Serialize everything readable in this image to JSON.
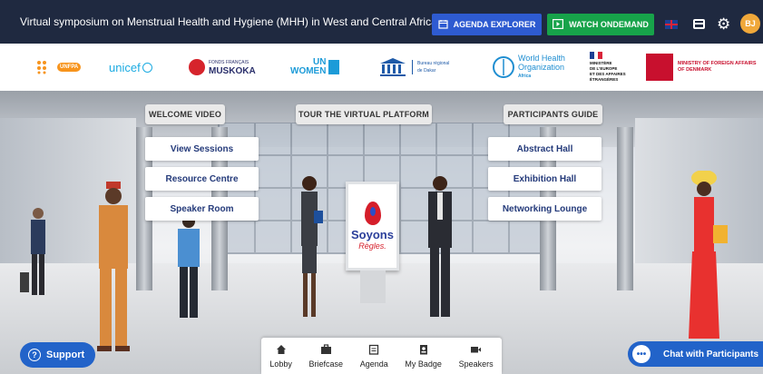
{
  "header": {
    "title": "Virtual symposium on Menstrual Health and Hygiene (MHH) in West and Central Africa",
    "agenda_label": "AGENDA EXPLORER",
    "ondemand_label": "WATCH ONDEMAND",
    "avatar_initials": "BJ"
  },
  "logos": {
    "unfpa": "UNFPA",
    "unicef": "unicef",
    "muskoka_small": "FONDS FRANÇAIS",
    "muskoka": "MUSKOKA",
    "unwomen_1": "UN",
    "unwomen_2": "WOMEN",
    "unesco_1": "Bureau régional",
    "unesco_2": "de Dakar",
    "who_1": "World Health",
    "who_2": "Organization",
    "who_3": "Africa",
    "france_1": "MINISTÈRE",
    "france_2": "DE L'EUROPE",
    "france_3": "ET DES AFFAIRES",
    "france_4": "ÉTRANGÈRES",
    "denmark_1": "MINISTRY OF FOREIGN AFFAIRS",
    "denmark_2": "OF DENMARK"
  },
  "signs": {
    "welcome": "WELCOME VIDEO",
    "tour": "TOUR THE VIRTUAL PLATFORM",
    "guide": "PARTICIPANTS GUIDE"
  },
  "halls": {
    "left": [
      "View Sessions",
      "Resource Centre",
      "Speaker Room"
    ],
    "right": [
      "Abstract Hall",
      "Exhibition Hall",
      "Networking Lounge"
    ]
  },
  "kiosk": {
    "line1": "Soyons",
    "line2": "Règles."
  },
  "bottom_nav": [
    {
      "label": "Lobby",
      "icon": "home-icon"
    },
    {
      "label": "Briefcase",
      "icon": "briefcase-icon"
    },
    {
      "label": "Agenda",
      "icon": "agenda-icon"
    },
    {
      "label": "My Badge",
      "icon": "badge-icon"
    },
    {
      "label": "Speakers",
      "icon": "video-icon"
    }
  ],
  "support_label": "Support",
  "chat_label": "Chat with Participants",
  "colors": {
    "topbar": "#1f2940",
    "agenda_btn": "#2e5bd1",
    "ondemand_btn": "#17a34a",
    "hall_text": "#243a7a",
    "support_btn": "#2263c9"
  }
}
